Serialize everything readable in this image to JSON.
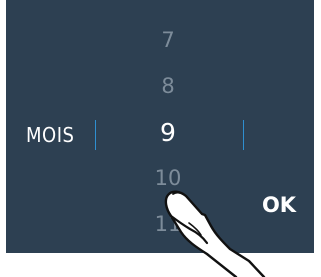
{
  "picker": {
    "label": "MOIS",
    "values": [
      "7",
      "8",
      "9",
      "10",
      "11"
    ],
    "selected": "9"
  },
  "actions": {
    "ok_label": "OK"
  },
  "colors": {
    "panel_bg": "#2d4052",
    "divider": "#2f8fd0",
    "dim_text": "#7d8c9a",
    "active_text": "#ffffff"
  },
  "icons": {
    "overlay": "finger-tap-icon"
  }
}
